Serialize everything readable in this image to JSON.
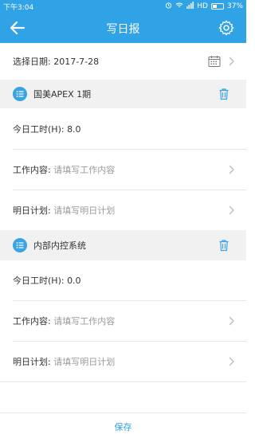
{
  "status_bar": {
    "time": "下午3:04",
    "network": "HD",
    "battery": "37%",
    "battery_level": 0.37
  },
  "app_bar": {
    "title": "写日报",
    "back_icon": "arrow-left-icon",
    "settings_icon": "gear-icon"
  },
  "date_row": {
    "label": "选择日期:",
    "value": "2017-7-28",
    "icon": "calendar-icon"
  },
  "sections": [
    {
      "name": "国美APEX 1期",
      "hours_label": "今日工时(H):",
      "hours_value": "8.0",
      "work_label": "工作内容:",
      "work_placeholder": "请填写工作内容",
      "plan_label": "明日计划:",
      "plan_placeholder": "请填写明日计划"
    },
    {
      "name": "内部内控系统",
      "hours_label": "今日工时(H):",
      "hours_value": "0.0",
      "work_label": "工作内容:",
      "work_placeholder": "请填写工作内容",
      "plan_label": "明日计划:",
      "plan_placeholder": "请填写明日计划"
    }
  ],
  "footer": {
    "save_label": "保存"
  },
  "colors": {
    "primary": "#2fa3e6",
    "section_bg": "#f1f1f1",
    "placeholder": "#9a9a9a"
  }
}
